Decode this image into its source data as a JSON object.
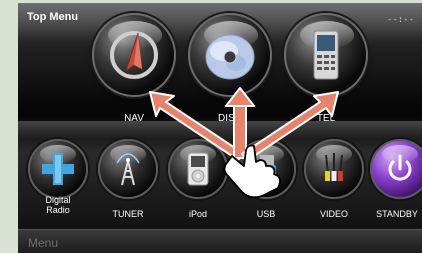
{
  "header": {
    "title": "Top Menu",
    "clock": "--:--"
  },
  "main_buttons": [
    {
      "label": "NAV",
      "icon": "navigation-arrow-icon"
    },
    {
      "label": "DISC",
      "icon": "disc-icon"
    },
    {
      "label": "TEL",
      "icon": "phone-icon"
    }
  ],
  "source_buttons": [
    {
      "label_line1": "Digital",
      "label_line2": "Radio",
      "icon": "digital-radio-icon"
    },
    {
      "label_line1": "TUNER",
      "label_line2": "",
      "icon": "tuner-tower-icon"
    },
    {
      "label_line1": "iPod",
      "label_line2": "",
      "icon": "ipod-icon"
    },
    {
      "label_line1": "USB",
      "label_line2": "",
      "icon": "usb-icon"
    },
    {
      "label_line1": "VIDEO",
      "label_line2": "",
      "icon": "video-cable-icon"
    },
    {
      "label_line1": "STANDBY",
      "label_line2": "",
      "icon": "power-icon"
    }
  ],
  "menu_bar": {
    "label": "Menu"
  },
  "colors": {
    "arrow": "#e8826a",
    "arrow_outline": "#ffffff",
    "frame": "#d9e2d2"
  }
}
